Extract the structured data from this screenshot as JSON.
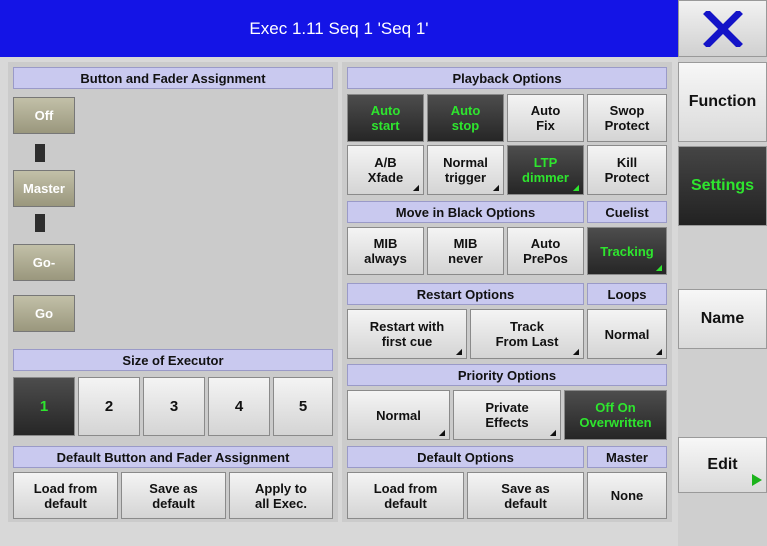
{
  "title": "Exec 1.11 Seq 1 'Seq 1'",
  "close_icon": "close-x-icon",
  "colors": {
    "title_bg": "#1414e6",
    "active_text": "#2ee52e",
    "section_header": "#c9c9ef",
    "close_x": "#1414c8"
  },
  "assignment": {
    "header": "Button and Fader Assignment",
    "buttons": [
      "Off",
      "Master",
      "Go-",
      "Go"
    ]
  },
  "size": {
    "header": "Size of Executor",
    "options": [
      "1",
      "2",
      "3",
      "4",
      "5"
    ],
    "selected": "1"
  },
  "default_assign": {
    "header": "Default Button and Fader Assignment",
    "load": "Load from\ndefault",
    "save": "Save as\ndefault",
    "apply": "Apply to\nall Exec."
  },
  "playback": {
    "header": "Playback Options",
    "auto_start": "Auto\nstart",
    "auto_stop": "Auto\nstop",
    "auto_fix": "Auto\nFix",
    "swop_protect": "Swop\nProtect",
    "ab_xfade": "A/B\nXfade",
    "normal_trigger": "Normal\ntrigger",
    "ltp_dimmer": "LTP\ndimmer",
    "kill_protect": "Kill\nProtect"
  },
  "mib": {
    "header": "Move in Black Options",
    "cuelist_header": "Cuelist",
    "always": "MIB\nalways",
    "never": "MIB\nnever",
    "auto_prepos": "Auto\nPrePos",
    "tracking": "Tracking"
  },
  "restart": {
    "header": "Restart Options",
    "loops_header": "Loops",
    "first_cue": "Restart with\nfirst cue",
    "track_last": "Track\nFrom Last",
    "loops_value": "Normal"
  },
  "priority": {
    "header": "Priority Options",
    "normal": "Normal",
    "private": "Private\nEffects",
    "off_on": "Off On\nOverwritten"
  },
  "default_opts": {
    "header": "Default Options",
    "master_header": "Master",
    "load": "Load from\ndefault",
    "save": "Save as\ndefault",
    "master_value": "None"
  },
  "sidebar": {
    "function": "Function",
    "settings": "Settings",
    "name": "Name",
    "edit": "Edit"
  }
}
